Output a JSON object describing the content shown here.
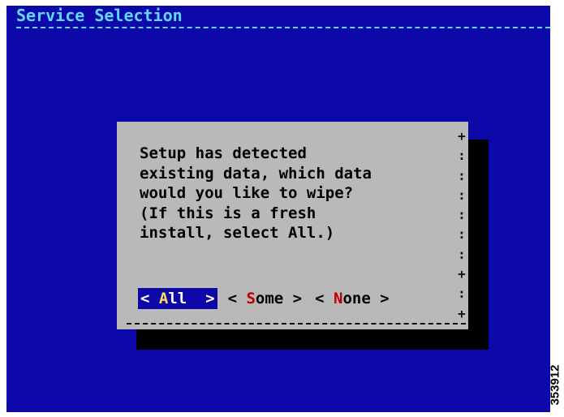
{
  "screen": {
    "title": "Service Selection",
    "background_color": "#0d08a8",
    "title_color": "#5fd7ff"
  },
  "dialog": {
    "message_lines": [
      "Setup has detected",
      "existing data, which data",
      "would you like to wipe?",
      "(If this is a fresh",
      "install, select All.)"
    ],
    "buttons": [
      {
        "open": "< ",
        "hotkey": "A",
        "rest": "ll",
        "close": "  >",
        "selected": true
      },
      {
        "open": "< ",
        "hotkey": "S",
        "rest": "ome",
        "close": " >",
        "selected": false
      },
      {
        "open": "< ",
        "hotkey": "N",
        "rest": "one",
        "close": " >",
        "selected": false
      }
    ],
    "edge_glyphs": "+\n:\n:\n:\n:\n:\n:\n+\n:\n+",
    "background_color": "#b9b9b9",
    "hotkey_color": "#c00000"
  },
  "figure_id": "353912"
}
